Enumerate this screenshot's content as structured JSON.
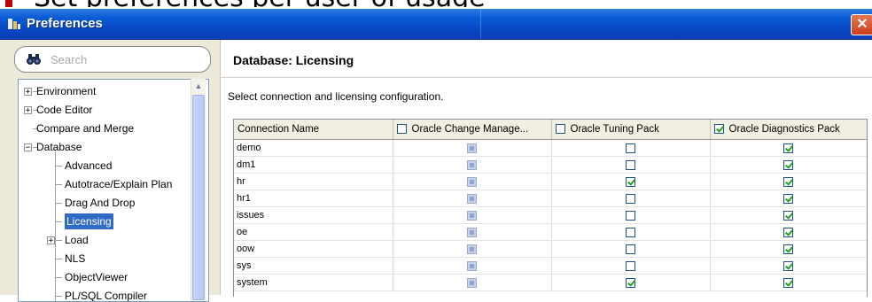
{
  "slide": {
    "title_fragment": "Set preferences per user of usage"
  },
  "dialog": {
    "title": "Preferences",
    "close_label": "✕"
  },
  "search": {
    "placeholder": "Search"
  },
  "tree": {
    "items": [
      {
        "label": "Environment",
        "level": 0,
        "expander": "+"
      },
      {
        "label": "Code Editor",
        "level": 0,
        "expander": "+"
      },
      {
        "label": "Compare and Merge",
        "level": 0,
        "expander": ""
      },
      {
        "label": "Database",
        "level": 0,
        "expander": "−"
      },
      {
        "label": "Advanced",
        "level": 1,
        "expander": ""
      },
      {
        "label": "Autotrace/Explain Plan",
        "level": 1,
        "expander": ""
      },
      {
        "label": "Drag And Drop",
        "level": 1,
        "expander": ""
      },
      {
        "label": "Licensing",
        "level": 1,
        "expander": "",
        "selected": true
      },
      {
        "label": "Load",
        "level": 1,
        "expander": "+"
      },
      {
        "label": "NLS",
        "level": 1,
        "expander": ""
      },
      {
        "label": "ObjectViewer",
        "level": 1,
        "expander": ""
      },
      {
        "label": "PL/SQL Compiler",
        "level": 1,
        "expander": ""
      }
    ]
  },
  "panel": {
    "heading": "Database: Licensing",
    "description": "Select connection and licensing configuration."
  },
  "table": {
    "columns": [
      {
        "label": "Connection Name",
        "header_checkbox": null
      },
      {
        "label": "Oracle Change Manage...",
        "header_checkbox": false
      },
      {
        "label": "Oracle Tuning Pack",
        "header_checkbox": false
      },
      {
        "label": "Oracle Diagnostics Pack",
        "header_checkbox": true
      }
    ],
    "rows": [
      {
        "name": "demo",
        "change_mgmt": "disabled",
        "tuning": false,
        "diagnostics": true
      },
      {
        "name": "dm1",
        "change_mgmt": "disabled",
        "tuning": false,
        "diagnostics": true
      },
      {
        "name": "hr",
        "change_mgmt": "disabled",
        "tuning": true,
        "diagnostics": true
      },
      {
        "name": "hr1",
        "change_mgmt": "disabled",
        "tuning": false,
        "diagnostics": true
      },
      {
        "name": "issues",
        "change_mgmt": "disabled",
        "tuning": false,
        "diagnostics": true
      },
      {
        "name": "oe",
        "change_mgmt": "disabled",
        "tuning": false,
        "diagnostics": true
      },
      {
        "name": "oow",
        "change_mgmt": "disabled",
        "tuning": false,
        "diagnostics": true
      },
      {
        "name": "sys",
        "change_mgmt": "disabled",
        "tuning": false,
        "diagnostics": true
      },
      {
        "name": "system",
        "change_mgmt": "disabled",
        "tuning": true,
        "diagnostics": true
      }
    ]
  },
  "colors": {
    "titlebar": "#0a5bd6",
    "selection": "#316ac5",
    "check": "#21a121"
  }
}
